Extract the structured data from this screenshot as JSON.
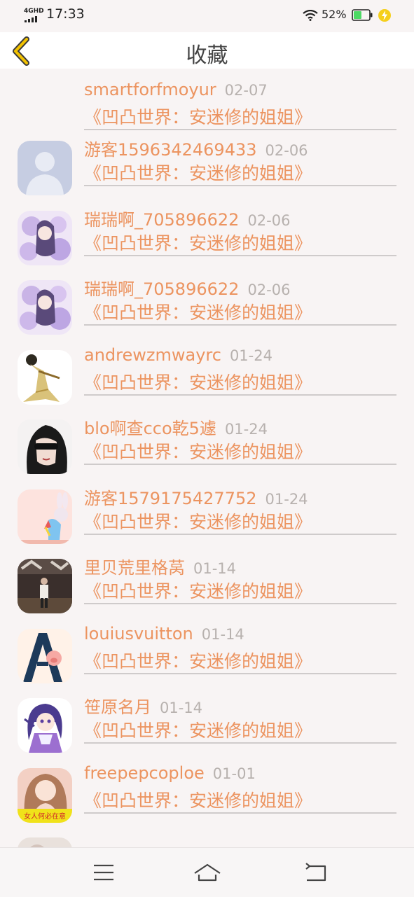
{
  "status_bar": {
    "network": "4GHD",
    "time": "17:33",
    "battery_percent": "52%",
    "battery_level": 0.52,
    "battery_color": "#4cd964",
    "icons": [
      "signal-icon",
      "wifi-icon",
      "battery-icon",
      "charging-bolt-icon"
    ]
  },
  "header": {
    "title": "收藏",
    "back_icon": "chevron-left-icon",
    "back_color": "#f2c200"
  },
  "colors": {
    "accent": "#ec9460",
    "date": "#b7b1ae",
    "background": "#f8f4f4"
  },
  "favorites": [
    {
      "username": "smartforfmoyur",
      "date": "02-07",
      "book": "《凹凸世界：安迷修的姐姐》",
      "avatar": "none"
    },
    {
      "username": "游客1596342469433",
      "date": "02-06",
      "book": "《凹凸世界：安迷修的姐姐》",
      "avatar": "default-person-avatar"
    },
    {
      "username": "瑞瑞啊_705896622",
      "date": "02-06",
      "book": "《凹凸世界：安迷修的姐姐》",
      "avatar": "anime-girl-purple-avatar"
    },
    {
      "username": "瑞瑞啊_705896622",
      "date": "02-06",
      "book": "《凹凸世界：安迷修的姐姐》",
      "avatar": "anime-girl-purple-avatar"
    },
    {
      "username": "andrewzmwayrc",
      "date": "01-24",
      "book": "《凹凸世界：安迷修的姐姐》",
      "avatar": "gardevoir-avatar"
    },
    {
      "username": "blo啊查cco乾5遽",
      "date": "01-24",
      "book": "《凹凸世界：安迷修的姐姐》",
      "avatar": "woman-sunglasses-avatar"
    },
    {
      "username": "游客1579175427752",
      "date": "01-24",
      "book": "《凹凸世界：安迷修的姐姐》",
      "avatar": "pony-rabbit-avatar"
    },
    {
      "username": "里贝荒里格莴",
      "date": "01-14",
      "book": "《凹凸世界：安迷修的姐姐》",
      "avatar": "man-street-avatar"
    },
    {
      "username": "louiusvuitton",
      "date": "01-14",
      "book": "《凹凸世界：安迷修的姐姐》",
      "avatar": "letter-a-pig-avatar"
    },
    {
      "username": "笹原名月",
      "date": "01-14",
      "book": "《凹凸世界：安迷修的姐姐》",
      "avatar": "anime-girl-violet-avatar"
    },
    {
      "username": "freepepcoploe",
      "date": "01-01",
      "book": "《凹凸世界：安迷修的姐姐》",
      "avatar": "woman-photo-avatar",
      "avatar_caption": "女人何必在意"
    }
  ],
  "bottom_nav": {
    "items": [
      "menu-icon",
      "home-icon",
      "back-icon"
    ]
  }
}
